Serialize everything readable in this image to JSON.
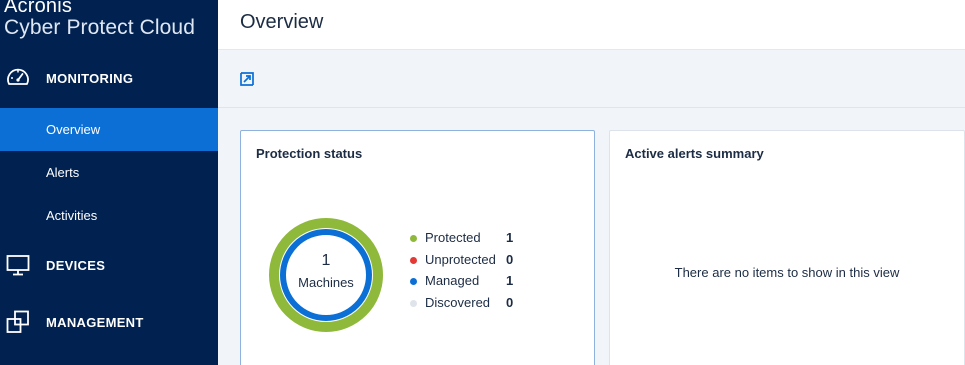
{
  "brand": {
    "line1": "Acronis",
    "line2": "Cyber Protect Cloud"
  },
  "sidebar": {
    "sections": [
      {
        "label": "MONITORING",
        "icon": "speedometer-icon"
      },
      {
        "label": "DEVICES",
        "icon": "monitor-icon"
      },
      {
        "label": "MANAGEMENT",
        "icon": "copy-squares-icon"
      }
    ],
    "monitoring_items": [
      {
        "label": "Overview",
        "active": true
      },
      {
        "label": "Alerts",
        "active": false
      },
      {
        "label": "Activities",
        "active": false
      }
    ]
  },
  "header": {
    "title": "Overview"
  },
  "toolbar": {
    "icon": "open-external-icon"
  },
  "widgets": {
    "protection": {
      "title": "Protection status",
      "count": "1",
      "count_label": "Machines",
      "legend": [
        {
          "label": "Protected",
          "value": "1",
          "color": "#8fb93b"
        },
        {
          "label": "Unprotected",
          "value": "0",
          "color": "#e53935"
        },
        {
          "label": "Managed",
          "value": "1",
          "color": "#0b6fd6"
        },
        {
          "label": "Discovered",
          "value": "0",
          "color": "#dfe4ea"
        }
      ]
    },
    "alerts": {
      "title": "Active alerts summary",
      "empty_text": "There are no items to show in this view"
    }
  },
  "colors": {
    "sidebar_bg": "#012250",
    "accent": "#0b6fd6",
    "protected": "#8fb93b"
  }
}
